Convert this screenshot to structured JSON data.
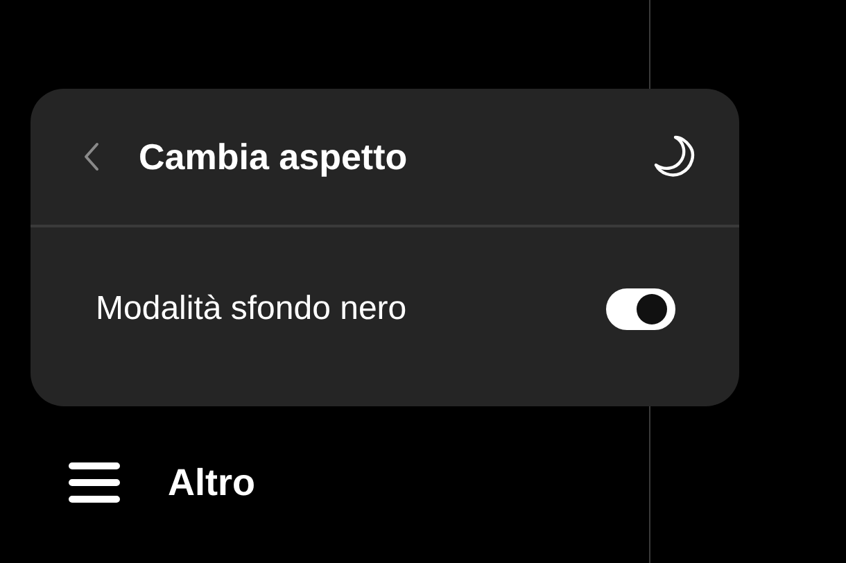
{
  "appearance_panel": {
    "title": "Cambia aspetto",
    "settings": [
      {
        "label": "Modalità sfondo nero",
        "kind": "toggle",
        "on": true
      }
    ]
  },
  "menu_item": {
    "label": "Altro"
  }
}
